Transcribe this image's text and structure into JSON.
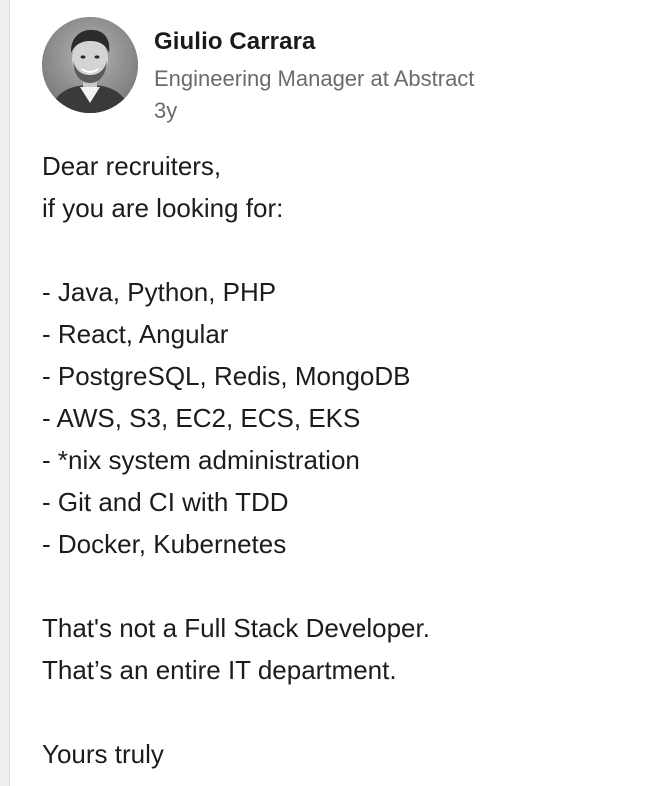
{
  "post": {
    "author": {
      "name": "Giulio Carrara",
      "headline": "Engineering Manager at Abstract",
      "age": "3y"
    },
    "body": {
      "greeting": "Dear recruiters,",
      "intro": "if you are looking for:",
      "skills": [
        "- Java, Python, PHP",
        "- React, Angular",
        "- PostgreSQL, Redis, MongoDB",
        "- AWS, S3, EC2, ECS, EKS",
        "- *nix system administration",
        "- Git and CI with TDD",
        "- Docker, Kubernetes"
      ],
      "conclusion_1": "That's not a Full Stack Developer.",
      "conclusion_2": "That’s an entire IT department.",
      "signoff": "Yours truly"
    }
  }
}
